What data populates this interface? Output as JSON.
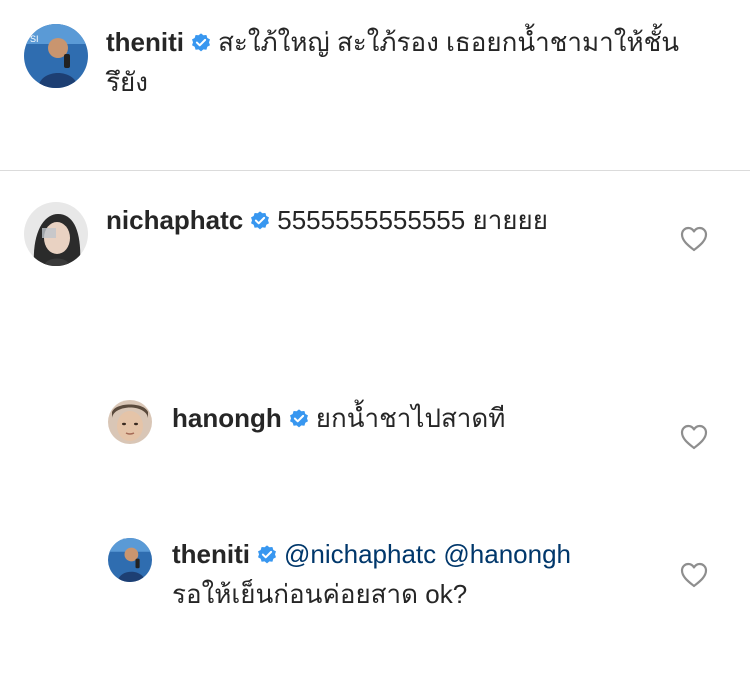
{
  "comments": [
    {
      "username": "theniti",
      "verified": true,
      "text_line1": "สะใภ้ใหญ่ สะใภ้รอง เธอยกน้ำชามาให้ชั้น",
      "text_line2": "รึยัง"
    },
    {
      "username": "nichaphatc",
      "verified": true,
      "text": "5555555555555 ยายยย"
    }
  ],
  "replies": [
    {
      "username": "hanongh",
      "verified": true,
      "text": "ยกน้ำชาไปสาดที"
    },
    {
      "username": "theniti",
      "verified": true,
      "mention1": "@nichaphatc",
      "mention2": "@hanongh",
      "text_line2": "รอให้เย็นก่อนค่อยสาด ok?"
    }
  ],
  "colors": {
    "verified_badge": "#3897f0",
    "mention": "#00376b",
    "divider": "#dbdbdb",
    "heart_outline": "#8e8e8e"
  },
  "icons": {
    "verified": "verified-badge-icon",
    "like": "heart-outline-icon"
  }
}
